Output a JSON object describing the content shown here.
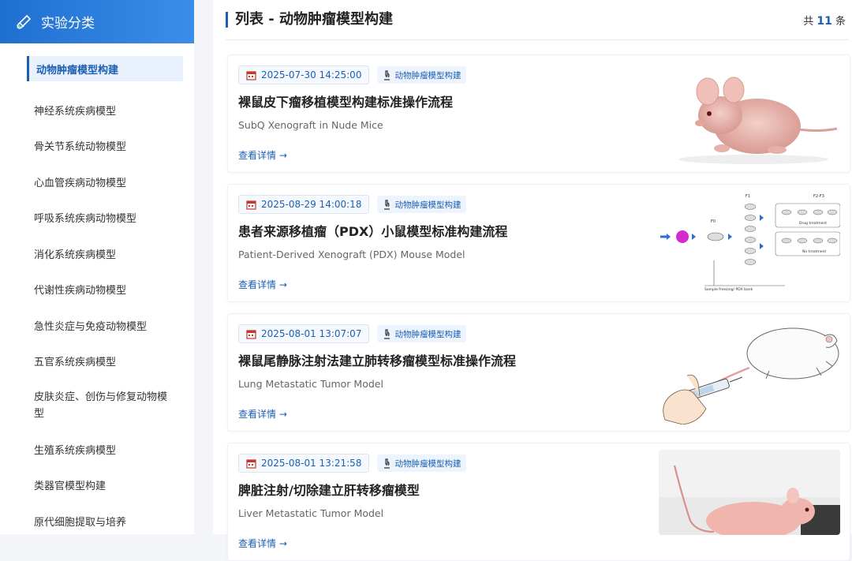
{
  "sidebar": {
    "title": "实验分类",
    "items": [
      {
        "label": "动物肿瘤模型构建",
        "active": true
      },
      {
        "label": "神经系统疾病模型"
      },
      {
        "label": "骨关节系统动物模型"
      },
      {
        "label": "心血管疾病动物模型"
      },
      {
        "label": "呼吸系统疾病动物模型"
      },
      {
        "label": "消化系统疾病模型"
      },
      {
        "label": "代谢性疾病动物模型"
      },
      {
        "label": "急性炎症与免疫动物模型"
      },
      {
        "label": "五官系统疾病模型"
      },
      {
        "label": "皮肤炎症、创伤与修复动物模型"
      },
      {
        "label": "生殖系统疾病模型"
      },
      {
        "label": "类器官模型构建"
      },
      {
        "label": "原代细胞提取与培养"
      }
    ]
  },
  "header": {
    "title": "列表 - 动物肿瘤模型构建",
    "count_prefix": "共",
    "count": "11",
    "count_suffix": "条"
  },
  "cards": [
    {
      "date": "2025-07-30 14:25:00",
      "tag": "动物肿瘤模型构建",
      "title": "裸鼠皮下瘤移植模型构建标准操作流程",
      "subtitle": "SubQ Xenograft in Nude Mice",
      "link": "查看详情 →"
    },
    {
      "date": "2025-08-29 14:00:18",
      "tag": "动物肿瘤模型构建",
      "title": "患者来源移植瘤（PDX）小鼠模型标准构建流程",
      "subtitle": "Patient-Derived Xenograft (PDX) Mouse Model",
      "link": "查看详情 →",
      "diagram": {
        "f0": "F0",
        "f1": "F1",
        "f23": "F2-F3",
        "drug": "Drug treatment",
        "none": "No treatment",
        "bank": "Sample freezing/ PDX bank"
      }
    },
    {
      "date": "2025-08-01 13:07:07",
      "tag": "动物肿瘤模型构建",
      "title": "裸鼠尾静脉注射法建立肺转移瘤模型标准操作流程",
      "subtitle": "Lung Metastatic Tumor Model",
      "link": "查看详情 →"
    },
    {
      "date": "2025-08-01 13:21:58",
      "tag": "动物肿瘤模型构建",
      "title": "脾脏注射/切除建立肝转移瘤模型",
      "subtitle": "Liver Metastatic Tumor Model",
      "link": "查看详情 →"
    }
  ],
  "colors": {
    "accent": "#1a5fb4",
    "sidebar_header": "#2a7de0"
  }
}
